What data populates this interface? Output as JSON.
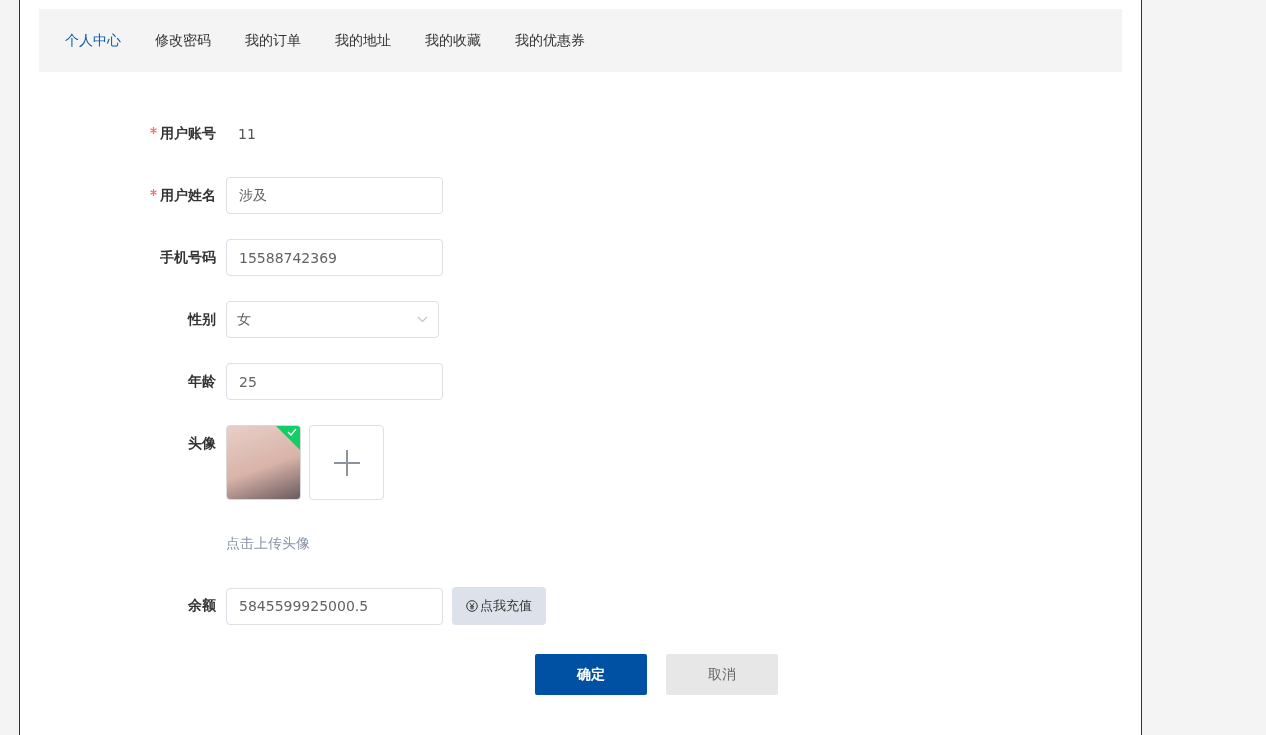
{
  "tabs": [
    {
      "label": "个人中心",
      "selected": true
    },
    {
      "label": "修改密码",
      "selected": false
    },
    {
      "label": "我的订单",
      "selected": false
    },
    {
      "label": "我的地址",
      "selected": false
    },
    {
      "label": "我的收藏",
      "selected": false
    },
    {
      "label": "我的优惠券",
      "selected": false
    }
  ],
  "fields": [
    {
      "kind": "text",
      "label": "用户账号",
      "required": true,
      "value": "11"
    },
    {
      "kind": "input",
      "label": "用户姓名",
      "required": true,
      "value": "涉及"
    },
    {
      "kind": "input",
      "label": "手机号码",
      "required": false,
      "value": "15588742369"
    },
    {
      "kind": "select",
      "label": "性别",
      "required": false,
      "value": "女"
    },
    {
      "kind": "input",
      "label": "年龄",
      "required": false,
      "value": "25"
    },
    {
      "kind": "avatar",
      "label": "头像",
      "required": false,
      "uploaded": true,
      "hint": "点击上传头像"
    },
    {
      "kind": "balance",
      "label": "余额",
      "required": false,
      "value": "5845599925000.5",
      "action": "点我充值"
    }
  ],
  "actions": [
    {
      "label": "确定",
      "kind": "primary"
    },
    {
      "label": "取消",
      "kind": "secondary"
    }
  ]
}
